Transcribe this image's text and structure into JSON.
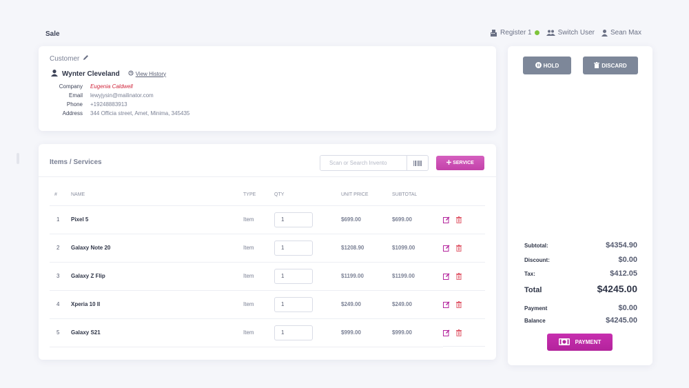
{
  "page": {
    "title": "Sale"
  },
  "topbar": {
    "register": "Register 1",
    "switch_user": "Switch User",
    "user": "Sean Max"
  },
  "customer": {
    "label": "Customer",
    "name": "Wynter Cleveland",
    "view_history": "View History",
    "details": [
      {
        "key": "Company",
        "value": "Eugenia Caldwell"
      },
      {
        "key": "Email",
        "value": "lewyjysin@mailinator.com"
      },
      {
        "key": "Phone",
        "value": "+19248883913"
      },
      {
        "key": "Address",
        "value": "344 Officia street, Amet, Minima, 345435"
      }
    ]
  },
  "items": {
    "title": "Items / Services",
    "search_placeholder": "Scan or Search Invento",
    "service_button": "SERVICE",
    "columns": [
      "#",
      "NAME",
      "TYPE",
      "QTY",
      "UNIT PRICE",
      "SUBTOTAL"
    ],
    "rows": [
      {
        "num": "1",
        "name": "Pixel 5",
        "type": "Item",
        "qty": "1",
        "unit_price": "$699.00",
        "subtotal": "$699.00"
      },
      {
        "num": "2",
        "name": "Galaxy Note 20",
        "type": "Item",
        "qty": "1",
        "unit_price": "$1208.90",
        "subtotal": "$1099.00"
      },
      {
        "num": "3",
        "name": "Galaxy Z Flip",
        "type": "Item",
        "qty": "1",
        "unit_price": "$1199.00",
        "subtotal": "$1199.00"
      },
      {
        "num": "4",
        "name": "Xperia 10 II",
        "type": "Item",
        "qty": "1",
        "unit_price": "$249.00",
        "subtotal": "$249.00"
      },
      {
        "num": "5",
        "name": "Galaxy S21",
        "type": "Item",
        "qty": "1",
        "unit_price": "$999.00",
        "subtotal": "$999.00"
      }
    ]
  },
  "actions": {
    "hold": "HOLD",
    "discard": "DISCARD"
  },
  "totals": {
    "subtotal_label": "Subtotal:",
    "subtotal": "$4354.90",
    "discount_label": "Discount:",
    "discount": "$0.00",
    "tax_label": "Tax:",
    "tax": "$412.05",
    "total_label": "Total",
    "total": "$4245.00",
    "payment_label": "Payment",
    "payment": "$0.00",
    "balance_label": "Balance",
    "balance": "$4245.00"
  },
  "payment_button": "PAYMENT",
  "colors": {
    "accent": "#c342aa",
    "danger": "#d0263c",
    "status_online": "#7ec43b",
    "button_gray": "#7d8799"
  }
}
